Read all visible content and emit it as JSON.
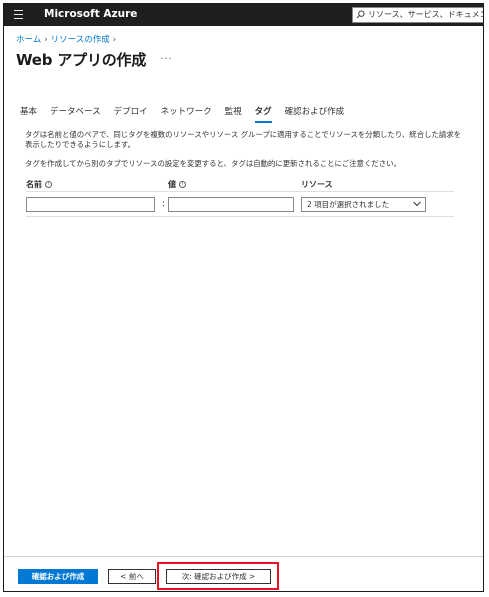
{
  "topbar": {
    "brand": "Microsoft Azure",
    "search_placeholder": "リソース、サービス、ドキュメントの検索"
  },
  "breadcrumb": [
    "ホーム",
    "リソースの作成"
  ],
  "page": {
    "title": "Web アプリの作成",
    "more": "···"
  },
  "tabs": [
    {
      "label": "基本"
    },
    {
      "label": "データベース"
    },
    {
      "label": "デプロイ"
    },
    {
      "label": "ネットワーク"
    },
    {
      "label": "監視"
    },
    {
      "label": "タグ"
    },
    {
      "label": "確認および作成"
    }
  ],
  "active_tab": "タグ",
  "description": {
    "line1": "タグは名前と値のペアで、同じタグを複数のリソースやリソース グループに適用することでリソースを分類したり、統合した請求を表示したりできるようにします。",
    "line2": "タグを作成してから別のタブでリソースの設定を変更すると、タグは自動的に更新されることにご注意ください。"
  },
  "table": {
    "headers": {
      "name": "名前",
      "value": "値",
      "resource": "リソース"
    },
    "info_glyph": "i",
    "row": {
      "name": "",
      "separator": ":",
      "value": "",
      "resource_selected": "2 項目が選択されました"
    }
  },
  "footer": {
    "review_create": "確認および作成",
    "prev": "< 前へ",
    "next": "次: 確認および作成 >"
  },
  "colors": {
    "topbar": "#1f1f1f",
    "accent": "#0078d4",
    "highlight": "#e81123"
  }
}
